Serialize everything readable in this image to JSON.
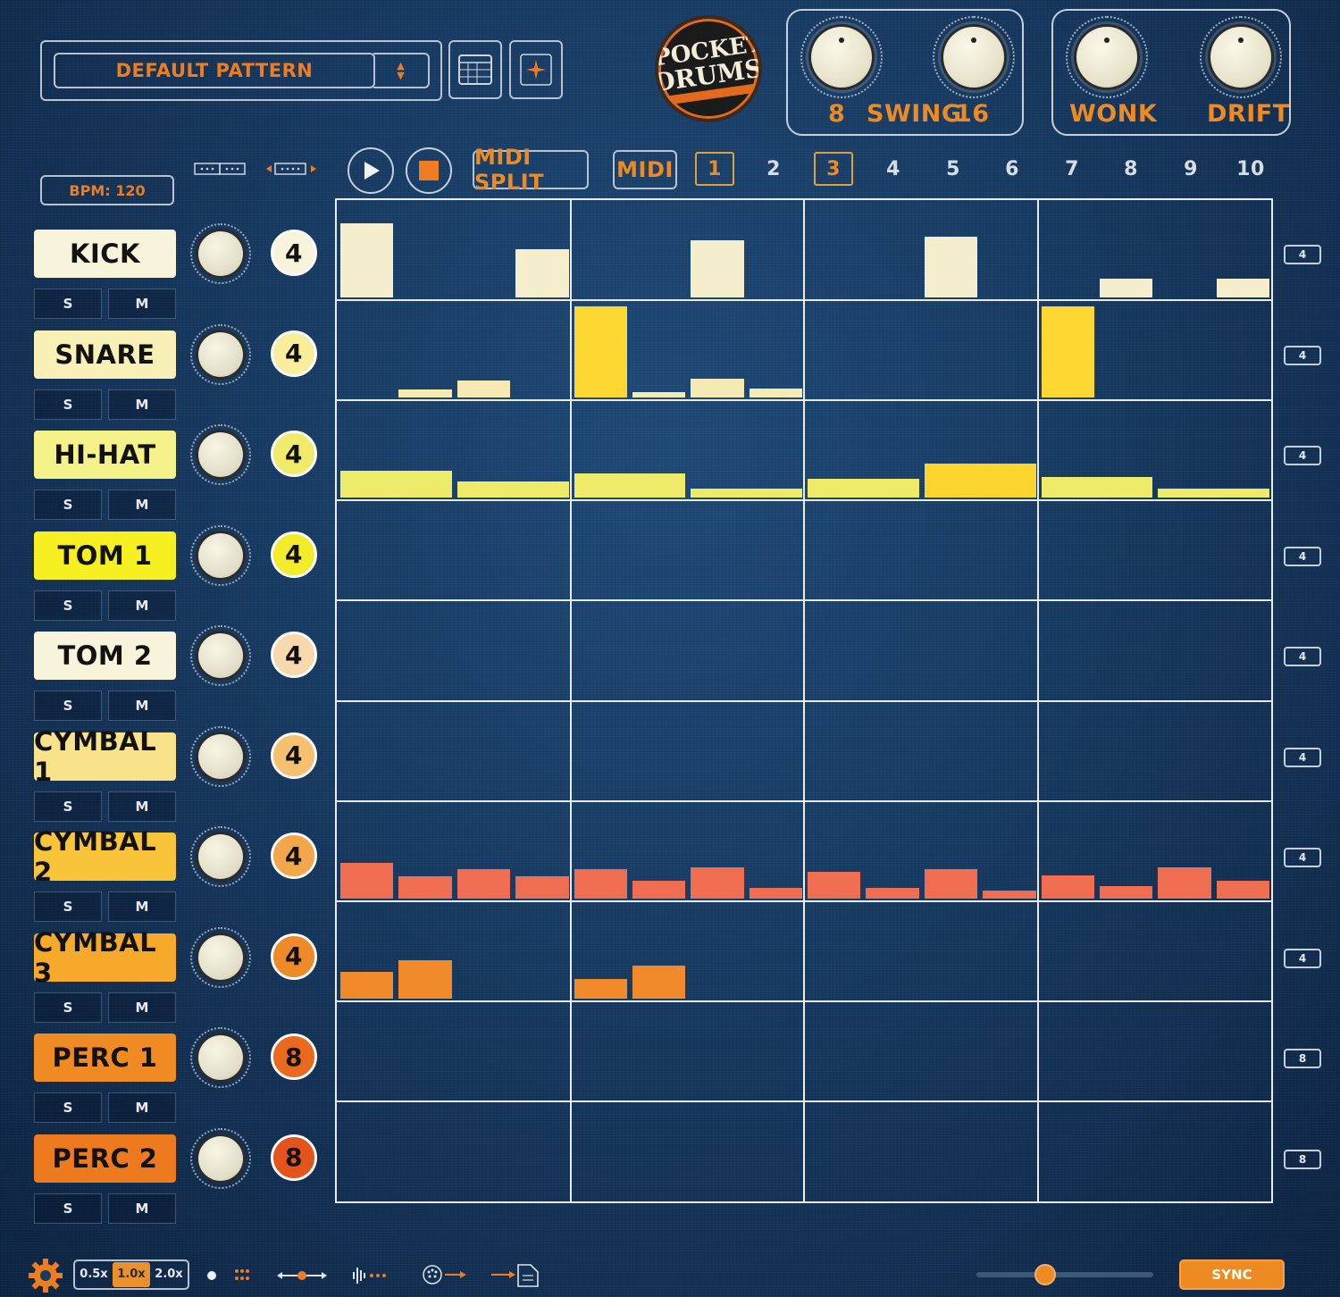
{
  "header": {
    "pattern_name": "DEFAULT PATTERN",
    "logo_line1": "POCKET",
    "logo_line2": "DRUMS",
    "swing_left": "8",
    "swing_label": "SWING",
    "swing_right": "16",
    "wonk_label": "WONK",
    "drift_label": "DRIFT"
  },
  "transport": {
    "bpm_label": "BPM: 120",
    "midi_split_label": "MIDI SPLIT",
    "midi_label": "MIDI",
    "pattern_numbers": [
      "1",
      "2",
      "3",
      "4",
      "5",
      "6",
      "7",
      "8",
      "9",
      "10"
    ],
    "active_patterns": [
      "1",
      "3"
    ]
  },
  "tracks": [
    {
      "name": "KICK",
      "steps": "4",
      "count": "4",
      "color": "#f8f4dc",
      "disc": "#f8f4dc"
    },
    {
      "name": "SNARE",
      "steps": "4",
      "count": "4",
      "color": "#f9f0b8",
      "disc": "#f8ee9c"
    },
    {
      "name": "HI-HAT",
      "steps": "4",
      "count": "4",
      "color": "#f5f28a",
      "disc": "#f0ec6a"
    },
    {
      "name": "TOM 1",
      "steps": "4",
      "count": "4",
      "color": "#f6ef21",
      "disc": "#f3ec2a"
    },
    {
      "name": "TOM 2",
      "steps": "4",
      "count": "4",
      "color": "#f8f4dc",
      "disc": "#f8d9ae"
    },
    {
      "name": "CYMBAL 1",
      "steps": "4",
      "count": "4",
      "color": "#f8e28a",
      "disc": "#f5c070"
    },
    {
      "name": "CYMBAL 2",
      "steps": "4",
      "count": "4",
      "color": "#f8c43a",
      "disc": "#f3a64a"
    },
    {
      "name": "CYMBAL 3",
      "steps": "4",
      "count": "4",
      "color": "#f6a92a",
      "disc": "#ee8a28"
    },
    {
      "name": "PERC 1",
      "steps": "8",
      "count": "8",
      "color": "#f08a22",
      "disc": "#e96a1e"
    },
    {
      "name": "PERC 2",
      "steps": "8",
      "count": "8",
      "color": "#ee7a20",
      "disc": "#e2541c"
    }
  ],
  "solo_label": "S",
  "mute_label": "M",
  "grid": {
    "rows": [
      {
        "color": "#f4eecd",
        "bars": [
          [
            0,
            0.8
          ],
          [
            3,
            0.52
          ],
          [
            6,
            0.62
          ],
          [
            10,
            0.65
          ],
          [
            13,
            0.2
          ],
          [
            15,
            0.2
          ]
        ]
      },
      {
        "color": "#f5eab4",
        "bars": [
          [
            1,
            0.09
          ],
          [
            2,
            0.18
          ],
          [
            5,
            0.06
          ],
          [
            6,
            0.2
          ],
          [
            7,
            0.1
          ],
          [
            4,
            0.98,
            "#fed832"
          ],
          [
            12,
            0.98,
            "#fed832"
          ]
        ]
      },
      {
        "color": "#eeea6a",
        "bars": [
          [
            0,
            0.29,
            "wide"
          ],
          [
            2,
            0.18,
            "wide"
          ],
          [
            4,
            0.26,
            "wide"
          ],
          [
            6,
            0.1,
            "wide"
          ],
          [
            8,
            0.2,
            "wide"
          ],
          [
            10,
            0.37,
            "wide",
            "#fbd52e"
          ],
          [
            12,
            0.22,
            "wide"
          ],
          [
            14,
            0.1,
            "wide"
          ]
        ]
      },
      {
        "color": "#ffffff",
        "bars": []
      },
      {
        "color": "#ffffff",
        "bars": []
      },
      {
        "color": "#ffffff",
        "bars": []
      },
      {
        "color": "#ef6e52",
        "bars": [
          [
            0,
            0.38
          ],
          [
            1,
            0.24
          ],
          [
            2,
            0.31
          ],
          [
            3,
            0.24
          ],
          [
            4,
            0.31
          ],
          [
            5,
            0.19
          ],
          [
            6,
            0.33
          ],
          [
            7,
            0.11
          ],
          [
            8,
            0.29
          ],
          [
            9,
            0.11
          ],
          [
            10,
            0.31
          ],
          [
            11,
            0.08
          ],
          [
            12,
            0.25
          ],
          [
            13,
            0.13
          ],
          [
            14,
            0.33
          ],
          [
            15,
            0.19
          ]
        ]
      },
      {
        "color": "#f08a2a",
        "bars": [
          [
            0,
            0.29
          ],
          [
            1,
            0.41
          ],
          [
            4,
            0.21
          ],
          [
            5,
            0.35
          ]
        ]
      },
      {
        "color": "#ffffff",
        "bars": []
      },
      {
        "color": "#ffffff",
        "bars": []
      }
    ]
  },
  "footer": {
    "speeds": [
      "0.5x",
      "1.0x",
      "2.0x"
    ],
    "active_speed": "1.0x",
    "sync_label": "SYNC",
    "slider_value": 0.39
  }
}
